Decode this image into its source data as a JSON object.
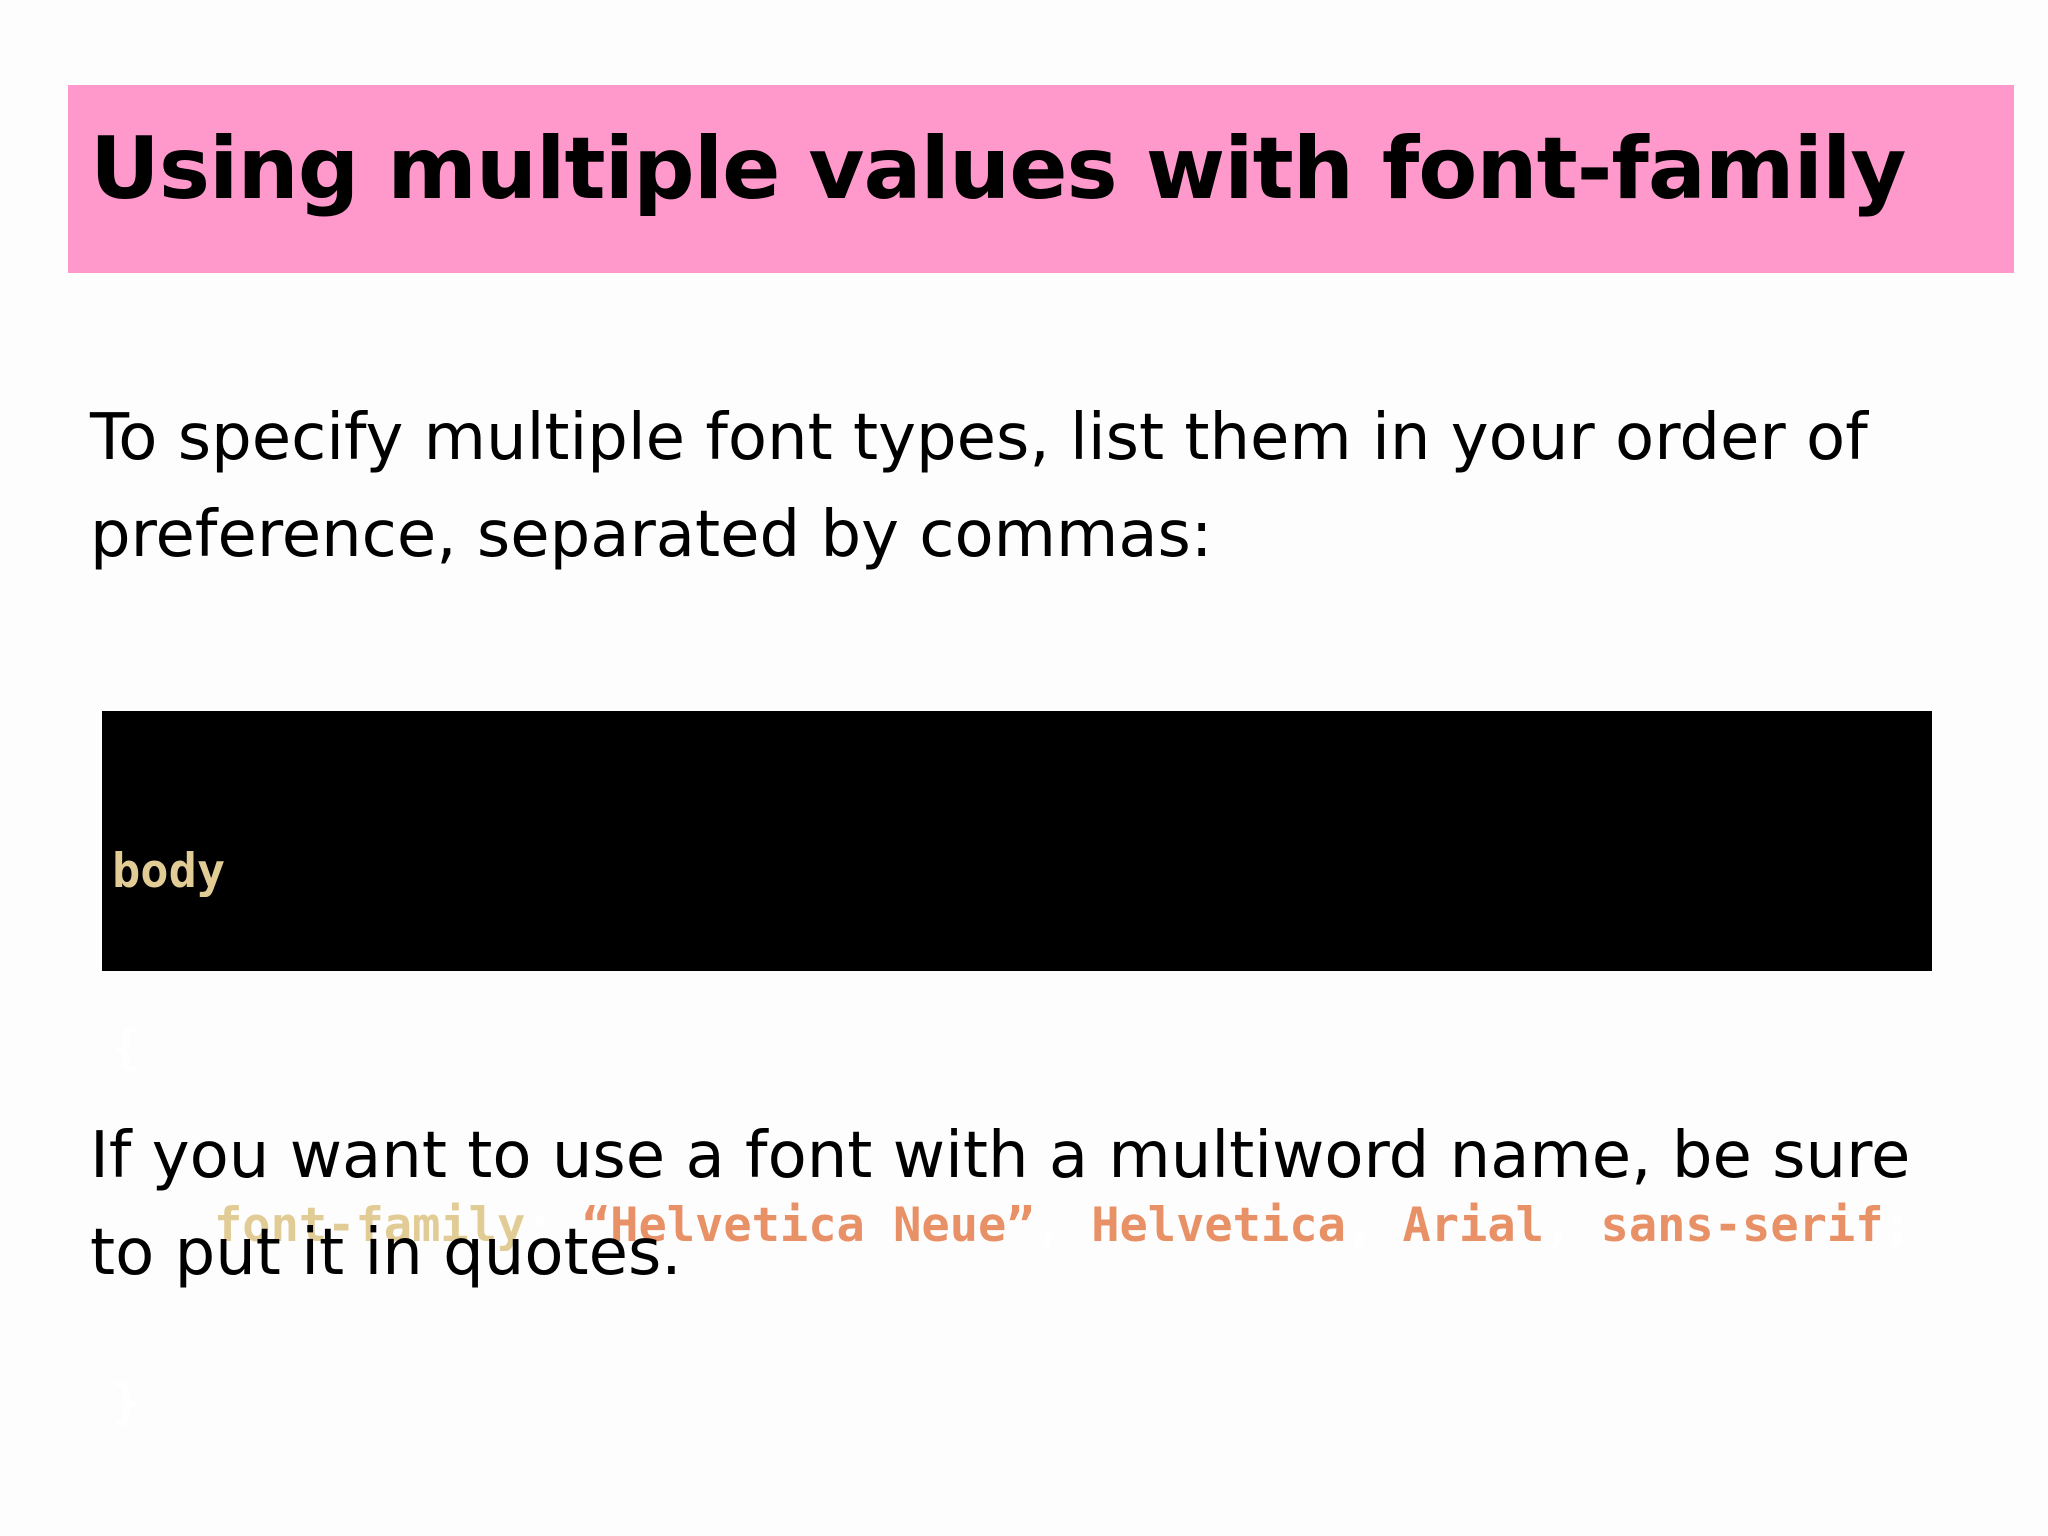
{
  "slide": {
    "title": "Using multiple values with font-family",
    "paragraph_1": {
      "line_1": "To specify multiple font types, list them in your order of",
      "line_2": "preference, separated by commas:"
    },
    "code": {
      "selector": "body",
      "open_brace": "{",
      "property": "font-family",
      "colon": ":",
      "values": [
        {
          "text": "“Helvetica Neue”",
          "sep": ","
        },
        {
          "text": "Helvetica",
          "sep": ","
        },
        {
          "text": "Arial",
          "sep": ","
        },
        {
          "text": "sans-serif",
          "sep": ";"
        }
      ],
      "close_brace": "}"
    },
    "paragraph_2": {
      "line_1": "If you want to use a font with a multiword name, be sure",
      "line_2": "to put it in quotes."
    },
    "colors": {
      "title_bar": "#ff99cc",
      "code_background": "#000000",
      "code_selector": "#e2cc96",
      "code_value": "#e89066"
    }
  }
}
